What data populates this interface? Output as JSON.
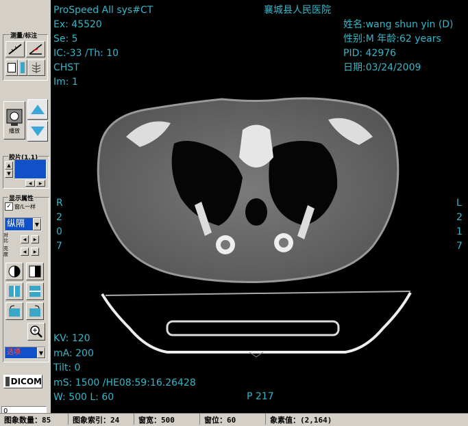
{
  "tools": {
    "measure_label": "测量/标注",
    "play_label": "播放",
    "film_label": "胶片(1,1)",
    "display_label": "显示属性",
    "same_checkbox_label": "窗/L一样",
    "orient_select": "纵隔",
    "contrast_label": "对比",
    "brightness_label": "亮度",
    "overlay_select": "选项",
    "dicom_button": "DICOM",
    "frame_input": "0"
  },
  "overlay": {
    "top_left": [
      "ProSpeed All  sys#CT",
      "Ex: 45520",
      "Se: 5",
      "IC:-33 /Th: 10",
      "CHST",
      "Im: 1"
    ],
    "hospital": "襄城县人民医院",
    "top_right": [
      "姓名:wang shun yin (D)",
      "性别:M  年龄:62 years",
      "PID: 42976",
      "日期:03/24/2009"
    ],
    "left_marker": [
      "R",
      "2",
      "0",
      "7"
    ],
    "right_marker": [
      "L",
      "2",
      "1",
      "7"
    ],
    "bottom_left": [
      "KV: 120",
      "mA: 200",
      "Tilt: 0",
      "mS: 1500  /HE08:59:16.26428",
      "W: 500 L: 60"
    ],
    "bottom_center": "P 217"
  },
  "status": {
    "image_count": "图象数量：85",
    "image_index": "图象索引：24",
    "window_width": "窗宽：500",
    "window_level": "窗位：60",
    "pixel_value": "象素值：(2,164)"
  },
  "colors": {
    "overlay_text": "#35b7c9",
    "panel": "#d4d0c8",
    "film_preview": "#1050c8",
    "overlay_select_text": "#c00000"
  }
}
